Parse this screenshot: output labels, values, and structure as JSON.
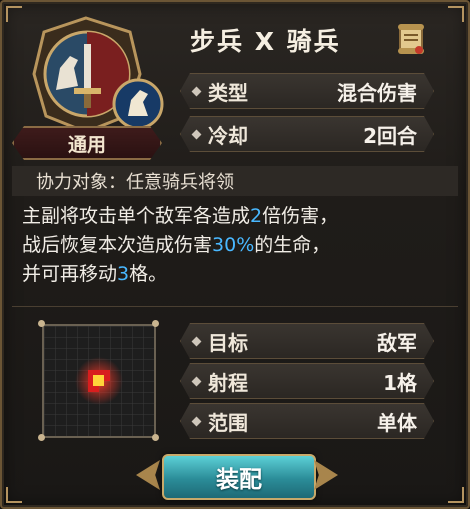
{
  "skill": {
    "title": "步兵 X 骑兵",
    "badge": "通用",
    "type_label": "类型",
    "type_value": "混合伤害",
    "cooldown_label": "冷却",
    "cooldown_value": "2回合",
    "coop_text": "协力对象：任意骑兵将领",
    "desc": {
      "l1a": "主副将攻击单个敌军各造成",
      "l1b": "2",
      "l1c": "倍伤害，",
      "l2a": "战后恢复本次造成伤害",
      "l2b": "30%",
      "l2c": "的生命，",
      "l3a": "并可再移动",
      "l3b": "3",
      "l3c": "格。"
    },
    "target_label": "目标",
    "target_value": "敌军",
    "range_label": "射程",
    "range_value": "1格",
    "area_label": "范围",
    "area_value": "单体",
    "equip_label": "装配"
  },
  "colors": {
    "highlight": "#49b8ff",
    "panel_border": "#6b5535",
    "equip_button": "#2b8c98"
  },
  "icons": {
    "emblem": "infantry-cavalry-emblem-icon",
    "horse": "horse-head-icon",
    "scroll": "scroll-icon"
  }
}
